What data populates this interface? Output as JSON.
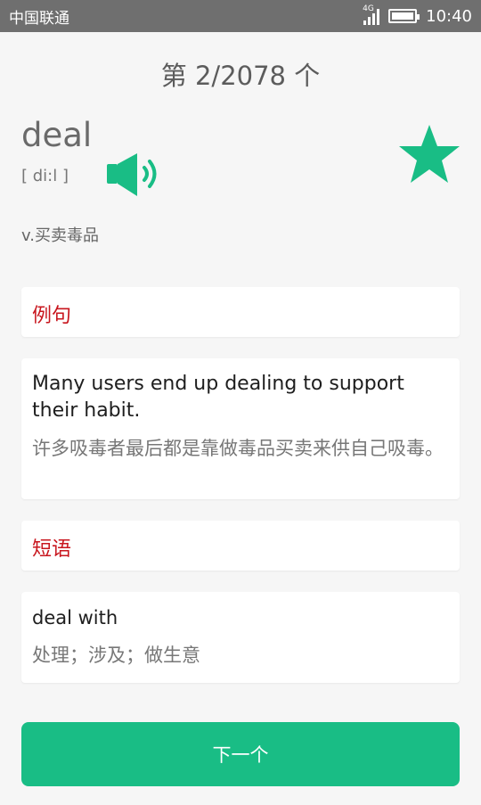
{
  "status_bar": {
    "carrier": "中国联通",
    "network": "4G",
    "time": "10:40"
  },
  "counter": "第 2/2078 个",
  "word": {
    "text": "deal",
    "phonetic": "[ di:l ]",
    "meaning": "v.买卖毒品",
    "favorite": true
  },
  "examples": {
    "title": "例句",
    "items": [
      {
        "en": "Many users end up dealing to support their habit.",
        "zh": "许多吸毒者最后都是靠做毒品买卖来供自己吸毒。"
      }
    ]
  },
  "phrases": {
    "title": "短语",
    "items": [
      {
        "en": "deal with",
        "zh": "处理；涉及；做生意"
      }
    ]
  },
  "next_button": "下一个",
  "colors": {
    "accent": "#19bd85",
    "section_title": "#c8161e",
    "status_bar": "#6f6f6f"
  },
  "icons": {
    "speaker": "speaker-icon",
    "star": "star-icon"
  }
}
